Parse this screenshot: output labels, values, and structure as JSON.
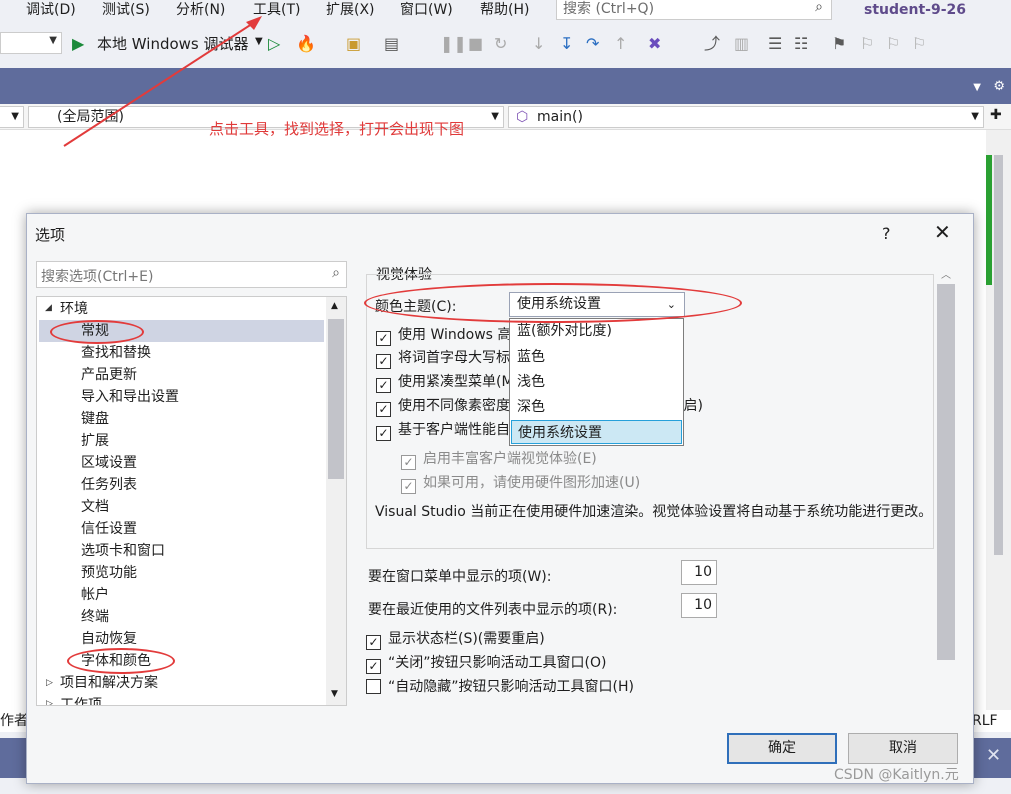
{
  "menu": {
    "debug": "调试(D)",
    "test": "测试(S)",
    "analyze": "分析(N)",
    "tools": "工具(T)",
    "extensions": "扩展(X)",
    "window": "窗口(W)",
    "help": "帮助(H)"
  },
  "search": {
    "placeholder": "搜索 (Ctrl+Q)"
  },
  "solution_name": "student-9-26",
  "toolbar": {
    "debugger_label": "本地 Windows 调试器"
  },
  "navbar": {
    "scope": "(全局范围)",
    "function": "main()"
  },
  "annotation": "点击工具，找到选择，打开会出现下图",
  "status": {
    "left_fragment": "作者",
    "right_fragment": "RLF"
  },
  "dialog": {
    "title": "选项",
    "help": "?",
    "close": "✕",
    "search_placeholder": "搜索选项(Ctrl+E)",
    "tree": {
      "root": "环境",
      "items": [
        "常规",
        "查找和替换",
        "产品更新",
        "导入和导出设置",
        "键盘",
        "扩展",
        "区域设置",
        "任务列表",
        "文档",
        "信任设置",
        "选项卡和窗口",
        "预览功能",
        "帐户",
        "终端",
        "自动恢复",
        "字体和颜色"
      ],
      "project": "项目和解决方案",
      "work_items": "工作项"
    },
    "section_title": "视觉体验",
    "theme_label": "颜色主题(C):",
    "theme_value": "使用系统设置",
    "theme_options": [
      "蓝(额外对比度)",
      "蓝色",
      "浅色",
      "深色",
      "使用系统设置"
    ],
    "checkboxes": [
      {
        "label": "使用 Windows 高对比度(Y)",
        "checked": true
      },
      {
        "label": "将词首字母大写标记在菜单栏中",
        "checked": true
      },
      {
        "label": "使用紧凑型菜单(M)",
        "checked": true
      },
      {
        "label": "使用不同像素密度的显示器时优化呈现(需要重启)",
        "checked": true
      },
      {
        "label": "基于客户端性能自动调整视觉体验",
        "checked": true
      }
    ],
    "sub_checkboxes": [
      {
        "label": "启用丰富客户端视觉体验(E)",
        "checked": true
      },
      {
        "label": "如果可用，请使用硬件图形加速(U)",
        "checked": true
      }
    ],
    "hw_note": "Visual Studio 当前正在使用硬件加速渲染。视觉体验设置将自动基于系统功能进行更改。",
    "window_menu_label": "要在窗口菜单中显示的项(W):",
    "window_menu_value": "10",
    "recent_files_label": "要在最近使用的文件列表中显示的项(R):",
    "recent_files_value": "10",
    "bottom_checkboxes": [
      {
        "label": "显示状态栏(S)(需要重启)",
        "checked": true
      },
      {
        "label": "“关闭”按钮只影响活动工具窗口(O)",
        "checked": true
      },
      {
        "label": "“自动隐藏”按钮只影响活动工具窗口(H)",
        "checked": false
      }
    ],
    "ok": "确定",
    "cancel": "取消"
  },
  "watermark": "CSDN @Kaitlyn.元"
}
